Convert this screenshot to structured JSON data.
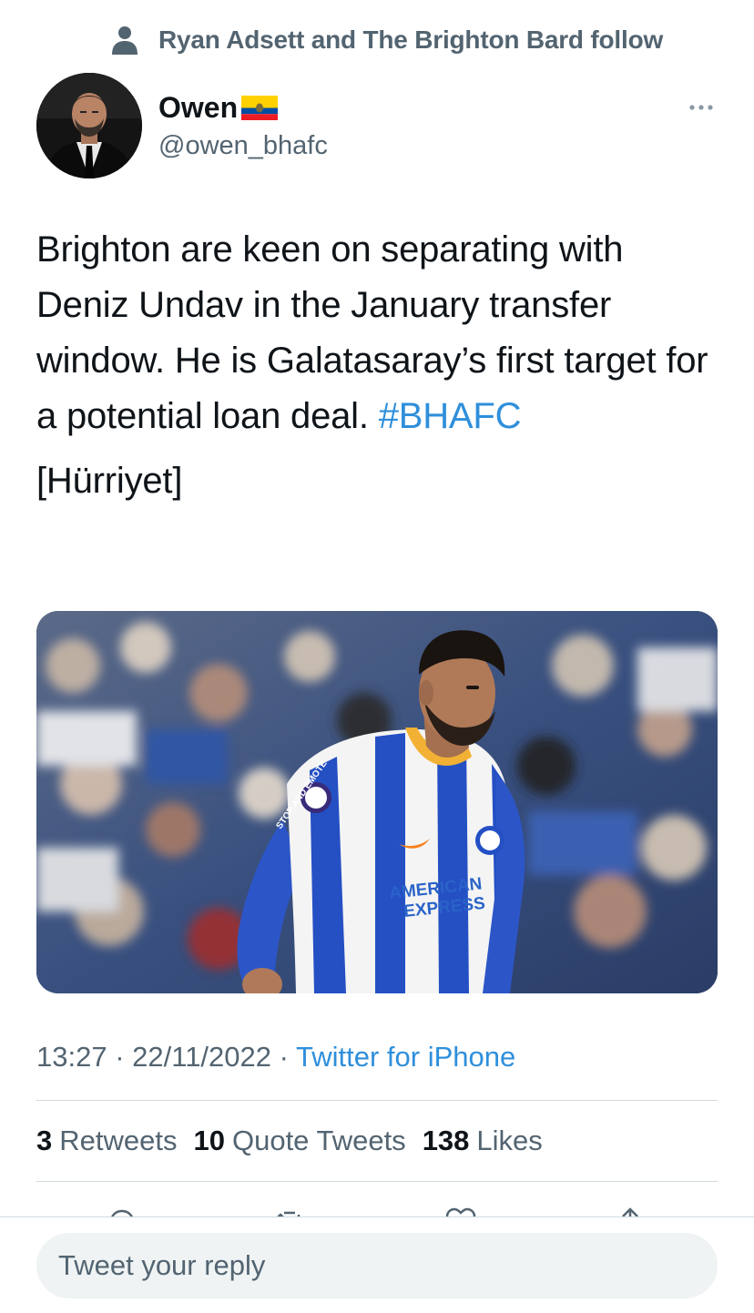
{
  "social_context": {
    "text": "Ryan Adsett and The Brighton Bard follow",
    "icon": "person-icon"
  },
  "author": {
    "name": "Owen",
    "handle": "@owen_bhafc",
    "flag": "ecuador-flag-icon"
  },
  "tweet": {
    "text": "Brighton are keen on separating with Deniz Undav in the January transfer window. He is Galatasaray’s first target for a potential loan deal.",
    "hashtag": "#BHAFC",
    "source": "[Hürriyet]"
  },
  "media": {
    "shirt_text_line1": "AMERICAN",
    "shirt_text_line2": "EXPRESS",
    "sleeve_text": "STOP AND EMOTE"
  },
  "meta": {
    "time": "13:27",
    "separator": "·",
    "date": "22/11/2022",
    "client": "Twitter for iPhone"
  },
  "stats": {
    "retweets": {
      "count": "3",
      "label": "Retweets"
    },
    "quotes": {
      "count": "10",
      "label": "Quote Tweets"
    },
    "likes": {
      "count": "138",
      "label": "Likes"
    }
  },
  "reply": {
    "placeholder": "Tweet your reply"
  },
  "colors": {
    "accent": "#1d9bf0",
    "secondary_text": "#536471",
    "divider": "#cfd9de",
    "reply_bg": "#eff3f4"
  }
}
